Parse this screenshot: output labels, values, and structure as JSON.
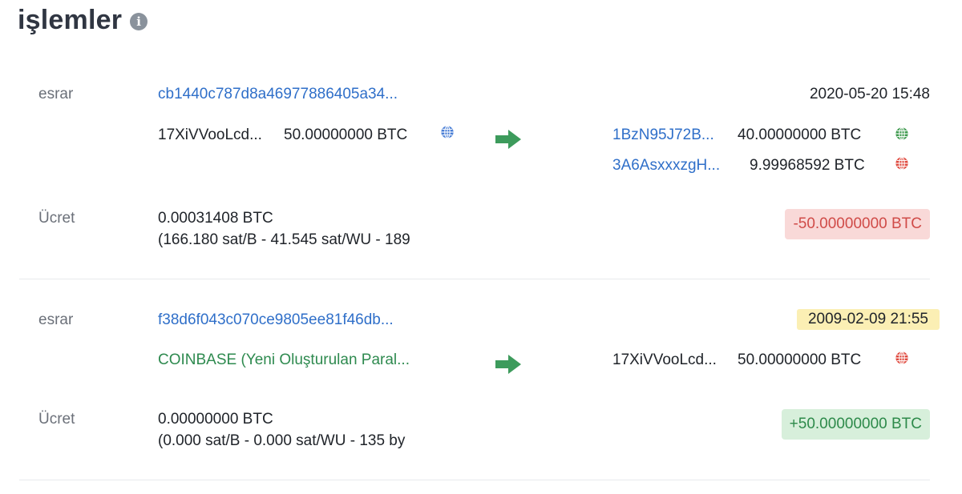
{
  "header": {
    "title": "işlemler",
    "info_icon": "i"
  },
  "transactions": [
    {
      "label": "esrar",
      "txid": "cb1440c787d8a46977886405a34...",
      "date": "2020-05-20 15:48",
      "date_highlighted": false,
      "input": {
        "address": "17XiVVooLcd...",
        "amount": "50.00000000 BTC",
        "globe_color": "#4a7fd6"
      },
      "outputs": [
        {
          "address": "1BzN95J72B...",
          "amount": "40.00000000 BTC",
          "globe_color": "#3e9a4e"
        },
        {
          "address": "3A6AsxxxzgH...",
          "amount": "9.99968592 BTC",
          "globe_color": "#e04a3f"
        }
      ],
      "fee_label": "Ücret",
      "fee": "0.00031408 BTC",
      "fee_detail": "(166.180 sat/B - 41.545 sat/WU - 189",
      "total": "-50.00000000 BTC"
    },
    {
      "label": "esrar",
      "txid": "f38d6f043c070ce9805ee81f46db...",
      "date": "2009-02-09 21:55",
      "date_highlighted": true,
      "input": {
        "address": "COINBASE (Yeni Oluşturulan Paral..."
      },
      "outputs": [
        {
          "address": "17XiVVooLcd...",
          "amount": "50.00000000 BTC",
          "globe_color": "#e04a3f"
        }
      ],
      "fee_label": "Ücret",
      "fee": "0.00000000 BTC",
      "fee_detail": "(0.000 sat/B - 0.000 sat/WU - 135 by",
      "total": "+50.00000000 BTC"
    }
  ],
  "colors": {
    "link": "#2f6fc9",
    "negative": "#d04b48",
    "positive": "#2d8a4a",
    "arrow": "#3d9b5c",
    "highlight": "#fbefb4"
  }
}
